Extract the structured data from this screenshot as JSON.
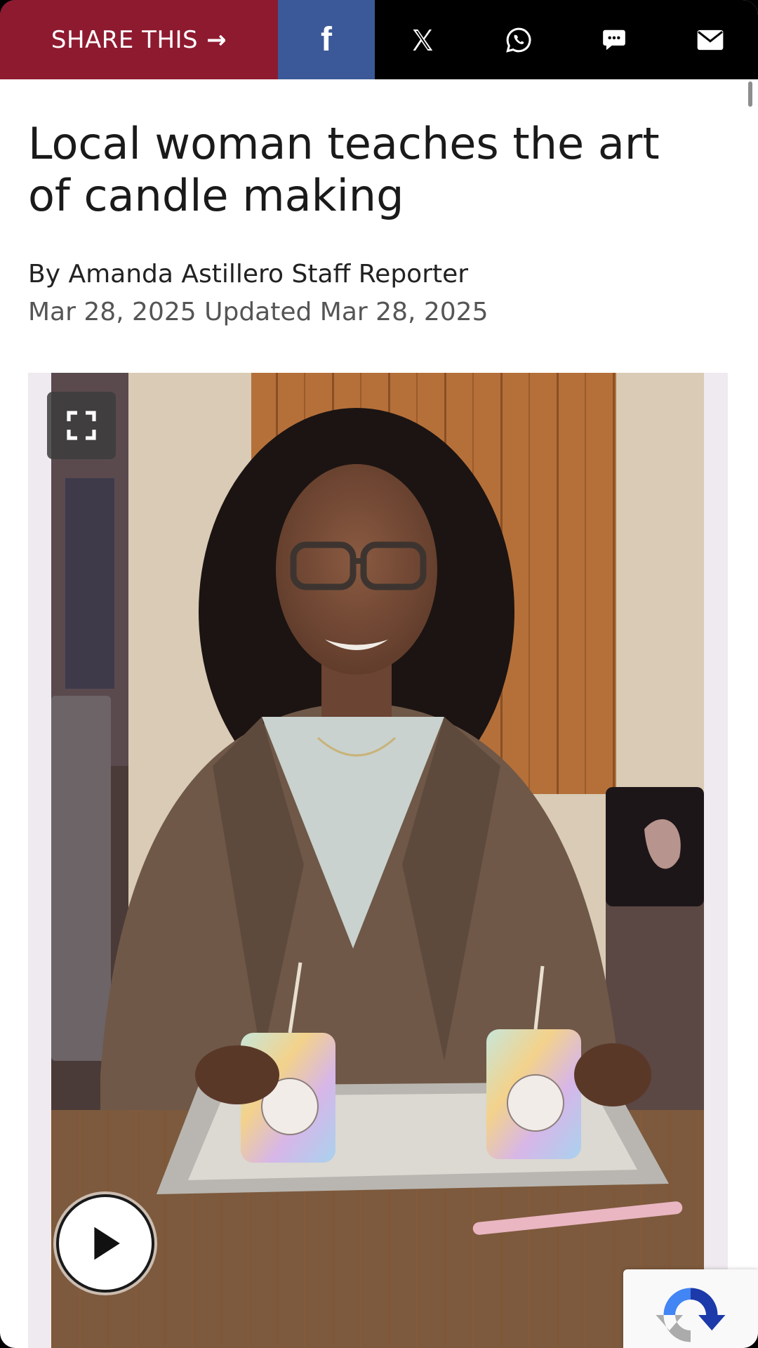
{
  "share_bar": {
    "label": "SHARE THIS",
    "arrow": "→",
    "facebook_glyph": "f",
    "icons": [
      "facebook-icon",
      "x-icon",
      "whatsapp-icon",
      "sms-icon",
      "email-icon"
    ],
    "colors": {
      "share": "#8e1a30",
      "facebook": "#3b5998",
      "bar": "#000000"
    }
  },
  "article": {
    "title": "Local woman teaches the art of candle making",
    "byline": "By Amanda Astillero Staff Reporter",
    "dateline": "Mar 28, 2025 Updated Mar 28, 2025"
  },
  "media": {
    "icons": [
      "fullscreen-icon",
      "play-icon",
      "recaptcha-icon"
    ]
  }
}
